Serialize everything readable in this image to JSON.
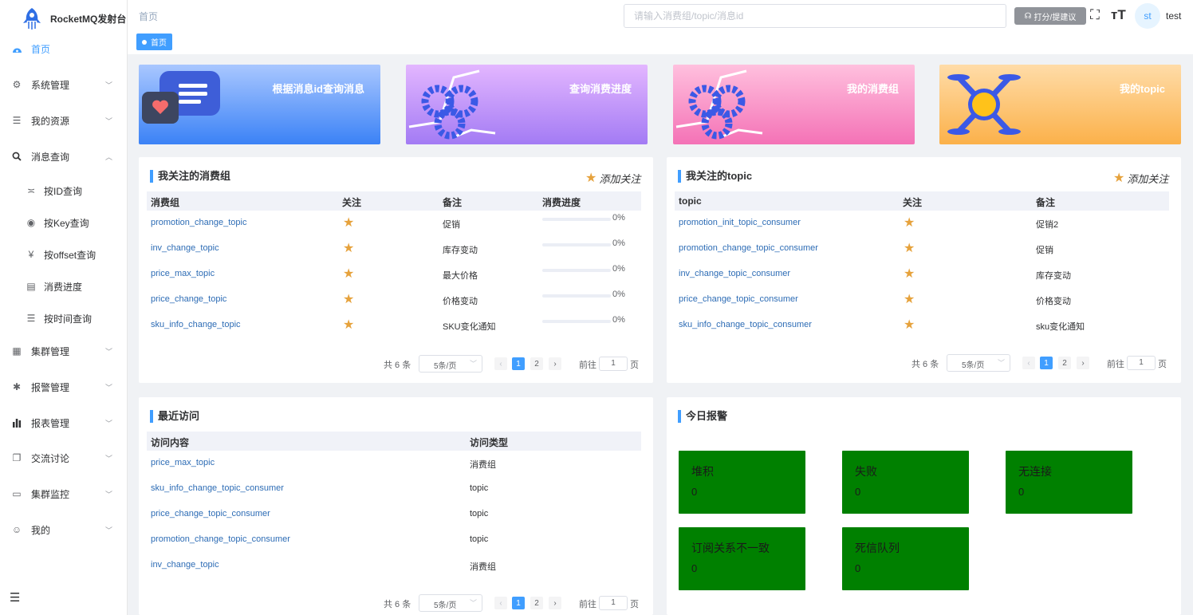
{
  "app": {
    "title": "RocketMQ发射台"
  },
  "sidebar": {
    "items": [
      {
        "label": "首页",
        "icon": "dashboard-icon",
        "active": true
      },
      {
        "label": "系统管理",
        "icon": "gear-icon"
      },
      {
        "label": "我的资源",
        "icon": "list-icon"
      },
      {
        "label": "消息查询",
        "icon": "search-icon",
        "expanded": true
      },
      {
        "label": "按ID查询",
        "icon": "eye-closed-icon",
        "sub": true
      },
      {
        "label": "按Key查询",
        "icon": "eye-icon",
        "sub": true
      },
      {
        "label": "按offset查询",
        "icon": "yen-icon",
        "sub": true
      },
      {
        "label": "消费进度",
        "icon": "document-icon",
        "sub": true
      },
      {
        "label": "按时间查询",
        "icon": "list-icon",
        "sub": true
      },
      {
        "label": "集群管理",
        "icon": "grid-icon"
      },
      {
        "label": "报警管理",
        "icon": "bug-icon"
      },
      {
        "label": "报表管理",
        "icon": "bar-chart-icon"
      },
      {
        "label": "交流讨论",
        "icon": "copy-icon"
      },
      {
        "label": "集群监控",
        "icon": "monitor-icon"
      },
      {
        "label": "我的",
        "icon": "user-icon"
      }
    ]
  },
  "header": {
    "breadcrumb": "首页",
    "tag": "首页",
    "search_placeholder": "请输入消费组/topic/消息id",
    "feedback_label": "打分/提建议",
    "avatar_text": "st",
    "username": "test"
  },
  "banners": [
    {
      "label": "根据消息id查询消息",
      "gradient": [
        "#a9c7ff",
        "#3b82f6"
      ]
    },
    {
      "label": "查询消费进度",
      "gradient": [
        "#e3b6ff",
        "#a37bf4"
      ]
    },
    {
      "label": "我的消费组",
      "gradient": [
        "#ffc0de",
        "#f472b6"
      ]
    },
    {
      "label": "我的topic",
      "gradient": [
        "#ffdca8",
        "#fbb14a"
      ]
    }
  ],
  "consumer_card": {
    "title": "我关注的消费组",
    "follow_label": "添加关注",
    "columns": [
      "消费组",
      "关注",
      "备注",
      "消费进度"
    ],
    "rows": [
      {
        "name": "promotion_change_topic",
        "note": "促销",
        "progress": "0%"
      },
      {
        "name": "inv_change_topic",
        "note": "库存变动",
        "progress": "0%"
      },
      {
        "name": "price_max_topic",
        "note": "最大价格",
        "progress": "0%"
      },
      {
        "name": "price_change_topic",
        "note": "价格变动",
        "progress": "0%"
      },
      {
        "name": "sku_info_change_topic",
        "note": "SKU变化通知",
        "progress": "0%"
      }
    ],
    "pager": {
      "total": "共 6 条",
      "size": "5条/页",
      "pages": [
        "1",
        "2"
      ],
      "goto": "前往",
      "goto_value": "1",
      "page_unit": "页"
    }
  },
  "topic_card": {
    "title": "我关注的topic",
    "follow_label": "添加关注",
    "columns": [
      "topic",
      "关注",
      "备注"
    ],
    "rows": [
      {
        "name": "promotion_init_topic_consumer",
        "note": "促销2"
      },
      {
        "name": "promotion_change_topic_consumer",
        "note": "促销"
      },
      {
        "name": "inv_change_topic_consumer",
        "note": "库存变动"
      },
      {
        "name": "price_change_topic_consumer",
        "note": "价格变动"
      },
      {
        "name": "sku_info_change_topic_consumer",
        "note": "sku变化通知"
      }
    ],
    "pager": {
      "total": "共 6 条",
      "size": "5条/页",
      "pages": [
        "1",
        "2"
      ],
      "goto": "前往",
      "goto_value": "1",
      "page_unit": "页"
    }
  },
  "recent_card": {
    "title": "最近访问",
    "columns": [
      "访问内容",
      "访问类型"
    ],
    "rows": [
      {
        "name": "price_max_topic",
        "type": "消费组"
      },
      {
        "name": "sku_info_change_topic_consumer",
        "type": "topic"
      },
      {
        "name": "price_change_topic_consumer",
        "type": "topic"
      },
      {
        "name": "promotion_change_topic_consumer",
        "type": "topic"
      },
      {
        "name": "inv_change_topic",
        "type": "消费组"
      }
    ],
    "pager": {
      "total": "共 6 条",
      "size": "5条/页",
      "pages": [
        "1",
        "2"
      ],
      "goto": "前往",
      "goto_value": "1",
      "page_unit": "页"
    }
  },
  "alarm_card": {
    "title": "今日报警",
    "color": "#008000",
    "items": [
      {
        "name": "堆积",
        "value": "0"
      },
      {
        "name": "失败",
        "value": "0"
      },
      {
        "name": "无连接",
        "value": "0"
      },
      {
        "name": "订阅关系不一致",
        "value": "0"
      },
      {
        "name": "死信队列",
        "value": "0"
      }
    ]
  }
}
